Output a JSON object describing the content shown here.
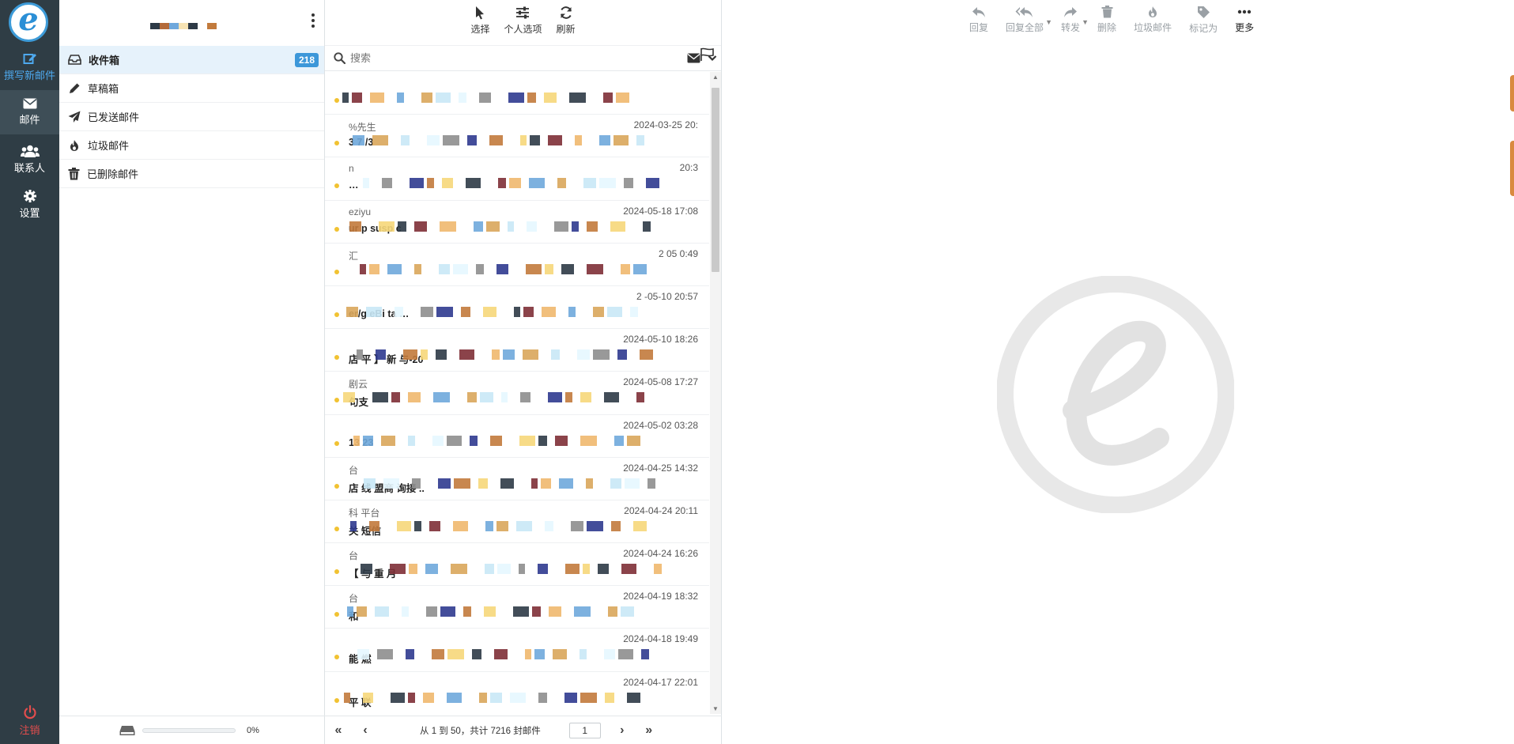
{
  "app": {
    "logo_glyph": "e",
    "accent": "#3c97d9"
  },
  "taskbar": {
    "compose": "撰写新邮件",
    "mail": "邮件",
    "contacts": "联系人",
    "settings": "设置",
    "logout": "注销"
  },
  "folders": [
    {
      "label": "收件箱",
      "icon": "inbox-icon",
      "count": "218",
      "active": true
    },
    {
      "label": "草稿箱",
      "icon": "pencil-icon"
    },
    {
      "label": "已发送邮件",
      "icon": "paper-plane-icon"
    },
    {
      "label": "垃圾邮件",
      "icon": "fire-icon"
    },
    {
      "label": "已删除邮件",
      "icon": "trash-icon"
    }
  ],
  "quota": {
    "percent_label": "0%",
    "fraction": 0
  },
  "list_toolbar": {
    "select": "选择",
    "options": "个人选项",
    "refresh": "刷新"
  },
  "search": {
    "placeholder": "搜索"
  },
  "messages": [
    {
      "from": "",
      "date": "",
      "subject": ""
    },
    {
      "from": "%先生",
      "date": "2024-03-25 20:",
      "subject": "3  7  /3"
    },
    {
      "from": "n",
      "date": "20:3",
      "subject": "…"
    },
    {
      "from": "eziyu",
      "date": "2024-05-18 17:08",
      "subject": "ur p  susp  c"
    },
    {
      "from": "汇",
      "date": "2  05  0:49",
      "subject": ""
    },
    {
      "from": "",
      "date": "2  -05-10 20:57",
      "subject": "er/g  eBi  ta  …"
    },
    {
      "from": "",
      "date": "2024-05-10 18:26",
      "subject": "店  平  】  新  与-20"
    },
    {
      "from": "剧云",
      "date": "2024-05-08 17:27",
      "subject": "句支"
    },
    {
      "from": "",
      "date": "2024-05-02 03:28",
      "subject": "13    23"
    },
    {
      "from": "台",
      "date": "2024-04-25 14:32",
      "subject": "店  线  盟商  询接  .."
    },
    {
      "from": "科  平台",
      "date": "2024-04-24 20:11",
      "subject": "关  短信"
    },
    {
      "from": "台",
      "date": "2024-04-24 16:26",
      "subject": "【  与  重  月"
    },
    {
      "from": "台",
      "date": "2024-04-19 18:32",
      "subject": "和"
    },
    {
      "from": "",
      "date": "2024-04-18 19:49",
      "subject": "能  燃"
    },
    {
      "from": "",
      "date": "2024-04-17 22:01",
      "subject": "平  联"
    }
  ],
  "pagination": {
    "summary": "从 1 到 50，共计 7216 封邮件",
    "page": "1"
  },
  "preview_toolbar": {
    "reply": "回复",
    "reply_all": "回复全部",
    "forward": "转发",
    "delete": "删除",
    "junk": "垃圾邮件",
    "mark": "标记为",
    "more": "更多"
  }
}
